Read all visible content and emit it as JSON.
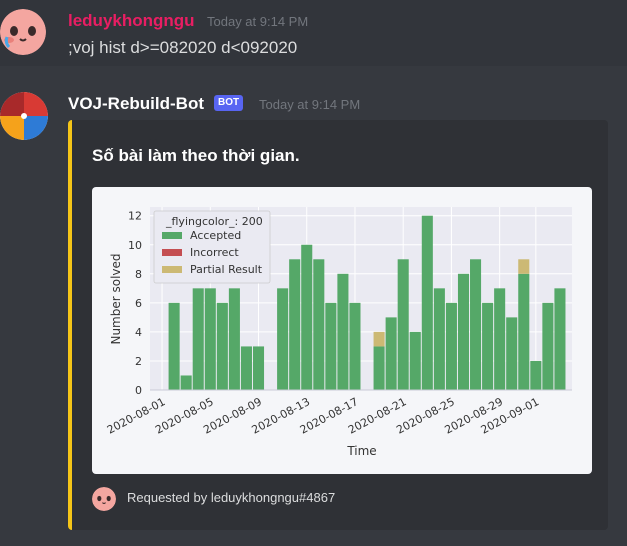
{
  "colors": {
    "username_color": "#e91e63",
    "bot_name_color": "#ffffff",
    "embed_accent": "#f5c518",
    "bot_tag": "#5865f2",
    "accepted": "#55a868",
    "incorrect": "#c44e52",
    "partial": "#ccb974"
  },
  "message1": {
    "author": "leduykhongngu",
    "timestamp": "Today at 9:14 PM",
    "content": ";voj hist d>=082020 d<092020",
    "avatar_icon": "pink-blob-face-avatar"
  },
  "message2": {
    "author": "VOJ-Rebuild-Bot",
    "bot_tag": "BOT",
    "timestamp": "Today at 9:14 PM",
    "avatar_icon": "voj-logo-avatar",
    "embed": {
      "title": "Số bài làm theo thời gian.",
      "footer_text": "Requested by leduykhongngu#4867"
    }
  },
  "chart_data": {
    "type": "bar",
    "stacked": true,
    "xlabel": "Time",
    "ylabel": "Number solved",
    "ylim": [
      0,
      12.6
    ],
    "yticks": [
      0,
      2,
      4,
      6,
      8,
      10,
      12
    ],
    "xticks": [
      "2020-08-01",
      "2020-08-05",
      "2020-08-09",
      "2020-08-13",
      "2020-08-17",
      "2020-08-21",
      "2020-08-25",
      "2020-08-29",
      "2020-09-01"
    ],
    "legend": {
      "title": "_flyingcolor_: 200",
      "placement": "top-left",
      "entries": [
        "Accepted",
        "Incorrect",
        "Partial Result"
      ]
    },
    "grid": true,
    "x": [
      "2020-08-02",
      "2020-08-03",
      "2020-08-04",
      "2020-08-05",
      "2020-08-06",
      "2020-08-07",
      "2020-08-08",
      "2020-08-09",
      "2020-08-11",
      "2020-08-12",
      "2020-08-13",
      "2020-08-14",
      "2020-08-15",
      "2020-08-16",
      "2020-08-17",
      "2020-08-19",
      "2020-08-20",
      "2020-08-21",
      "2020-08-22",
      "2020-08-23",
      "2020-08-24",
      "2020-08-25",
      "2020-08-26",
      "2020-08-27",
      "2020-08-28",
      "2020-08-29",
      "2020-08-30",
      "2020-08-31",
      "2020-09-01",
      "2020-09-02",
      "2020-09-03"
    ],
    "series": [
      {
        "name": "Accepted",
        "values": [
          6,
          1,
          7,
          7,
          6,
          7,
          3,
          3,
          7,
          9,
          10,
          9,
          6,
          8,
          6,
          3,
          5,
          9,
          4,
          12,
          7,
          6,
          8,
          9,
          6,
          7,
          5,
          8,
          2,
          6,
          7
        ]
      },
      {
        "name": "Incorrect",
        "values": [
          0,
          0,
          0,
          0,
          0,
          0,
          0,
          0,
          0,
          0,
          0,
          0,
          0,
          0,
          0,
          0,
          0,
          0,
          0,
          0,
          0,
          0,
          0,
          0,
          0,
          0,
          0,
          0,
          0,
          0,
          0
        ]
      },
      {
        "name": "Partial Result",
        "values": [
          0,
          0,
          0,
          0,
          0,
          0,
          0,
          0,
          0,
          0,
          0,
          0,
          0,
          0,
          0,
          1,
          0,
          0,
          0,
          0,
          0,
          0,
          0,
          0,
          0,
          0,
          0,
          1,
          0,
          0,
          0
        ]
      }
    ]
  }
}
